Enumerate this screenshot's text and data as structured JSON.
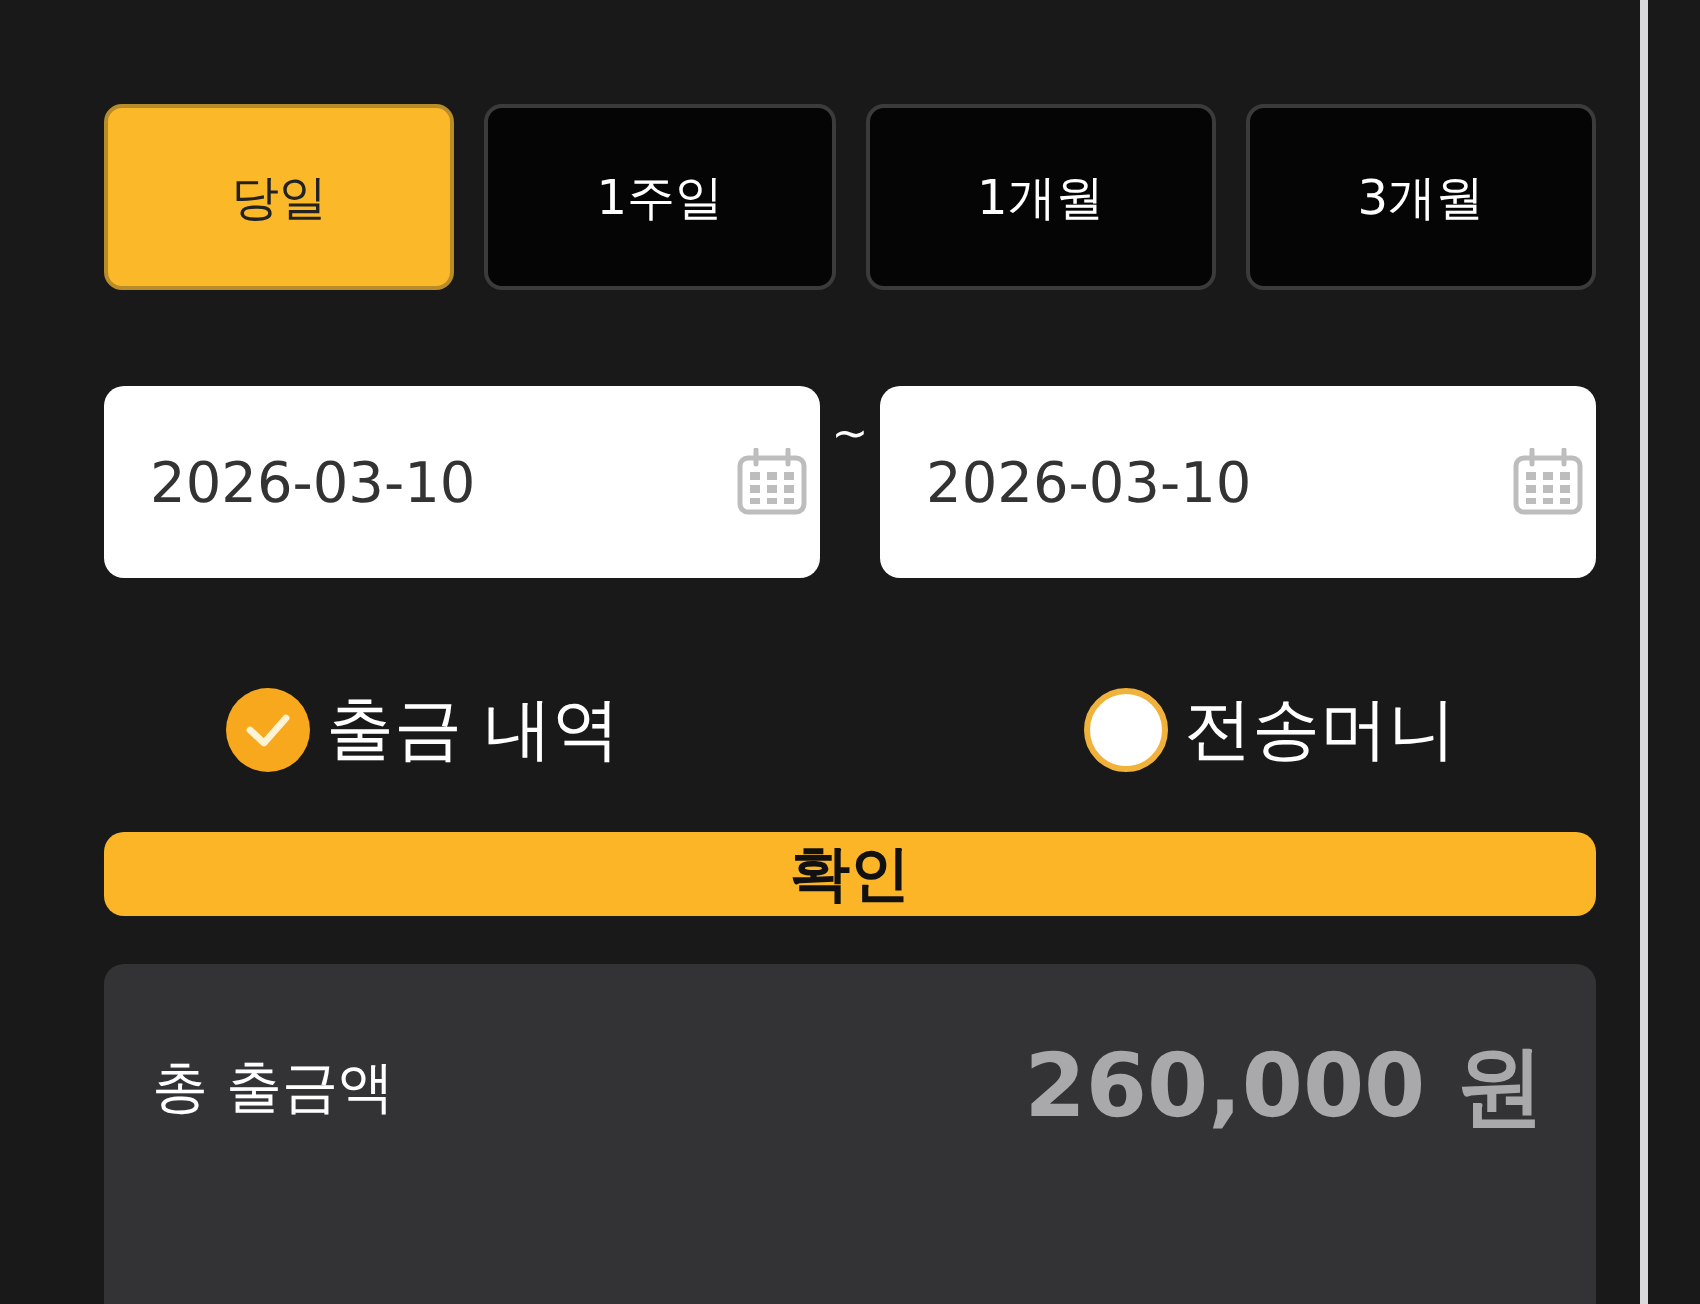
{
  "period_tabs": [
    {
      "label": "당일",
      "selected": true
    },
    {
      "label": "1주일",
      "selected": false
    },
    {
      "label": "1개월",
      "selected": false
    },
    {
      "label": "3개월",
      "selected": false
    }
  ],
  "date_range": {
    "start": "2026-03-10",
    "separator": "~",
    "end": "2026-03-10"
  },
  "history_types": [
    {
      "label": "출금 내역",
      "selected": true
    },
    {
      "label": "전송머니",
      "selected": false
    }
  ],
  "confirm_button": {
    "label": "확인"
  },
  "summary": {
    "label": "총 출금액",
    "amount": "260,000 원"
  }
}
